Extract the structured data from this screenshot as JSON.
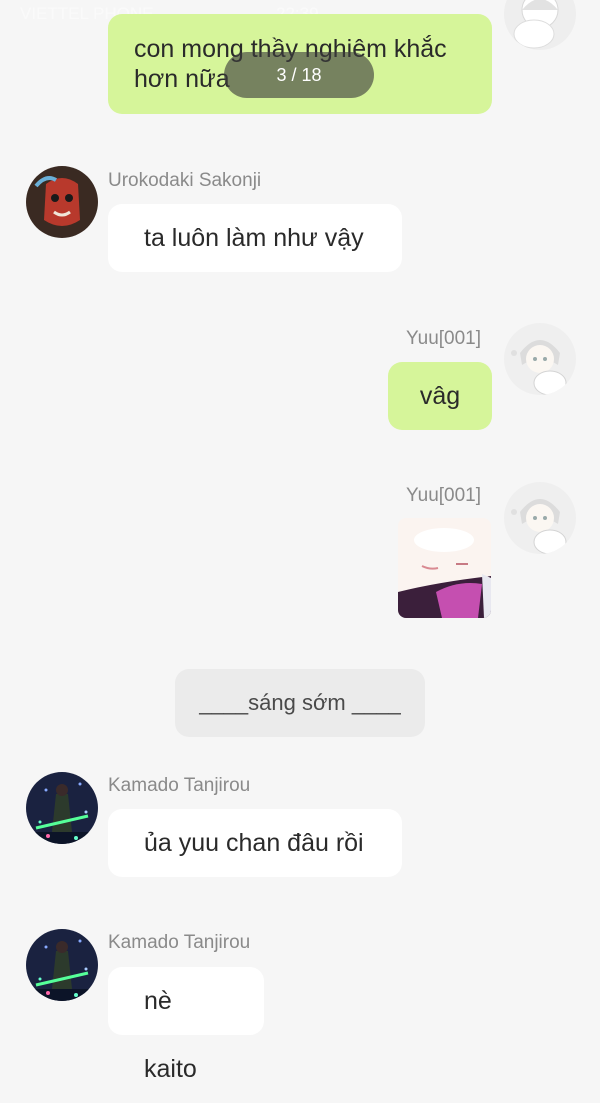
{
  "status_bar": {
    "carrier": "VIETTEL PHONE",
    "time": "22:39"
  },
  "pager": {
    "label": "3 / 18"
  },
  "messages": [
    {
      "sender": "",
      "direction": "outgoing",
      "text": "con mong thầy nghiêm khắc hơn nữa"
    },
    {
      "sender": "Urokodaki Sakonji",
      "direction": "incoming",
      "text": "ta luôn làm như vậy"
    },
    {
      "sender": "Yuu[001]",
      "direction": "outgoing",
      "text": "vâg"
    },
    {
      "sender": "Yuu[001]",
      "direction": "outgoing",
      "text": "",
      "image": "anime-face-image"
    },
    {
      "sender": "Kamado Tanjirou",
      "direction": "incoming",
      "text": "ủa yuu chan đâu rồi"
    },
    {
      "sender": "Kamado Tanjirou",
      "direction": "incoming",
      "text": "nè kaito"
    }
  ],
  "divider": {
    "text": "____sáng sớm ____"
  },
  "colors": {
    "outgoing_bubble": "#d6f59a",
    "incoming_bubble": "#ffffff",
    "background": "#f6f6f6"
  }
}
